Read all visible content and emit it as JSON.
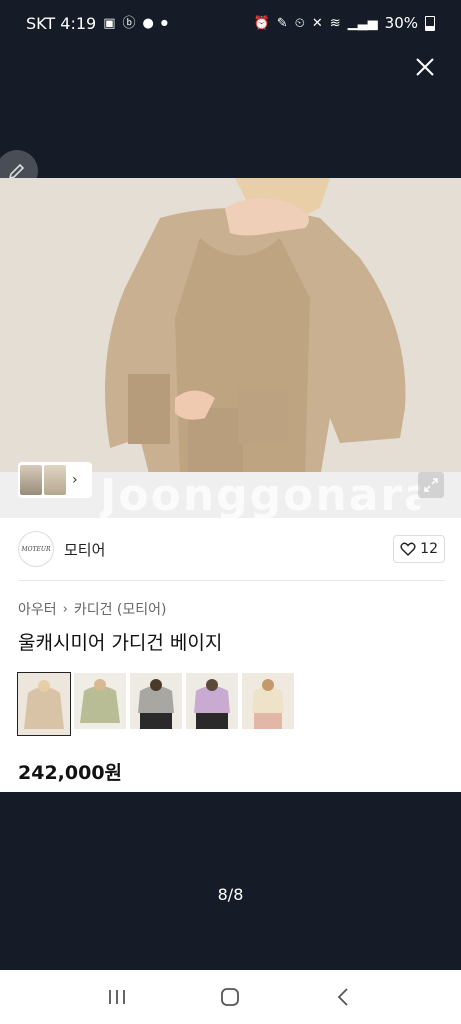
{
  "status_bar": {
    "carrier_time": "SKT 4:19",
    "battery": "30%",
    "left_icons": [
      "gallery-icon",
      "b-app-icon",
      "chat-icon",
      "dot-icon"
    ],
    "right_icons": [
      "alarm-lock-icon",
      "pen-icon",
      "alarm-icon",
      "mute-icon",
      "wifi-icon",
      "signal-icon",
      "battery-icon"
    ]
  },
  "viewer": {
    "watermark": "Joonggonara",
    "counter": "8/8"
  },
  "seller": {
    "logo_text": "MOTEUR",
    "name": "모티어",
    "likes": "12"
  },
  "product": {
    "breadcrumb": [
      "아우터",
      "카디건 (모티어)"
    ],
    "title": "울캐시미어 가디건 베이지",
    "price": "242,000원",
    "color_thumbnails": [
      "beige",
      "green",
      "gray",
      "lavender",
      "cream"
    ]
  },
  "colors": {
    "beige": "#d8c3a6",
    "green": "#b9bd95",
    "gray": "#a8a7a2",
    "lavender": "#c9abd1",
    "cream": "#eee3c8"
  }
}
